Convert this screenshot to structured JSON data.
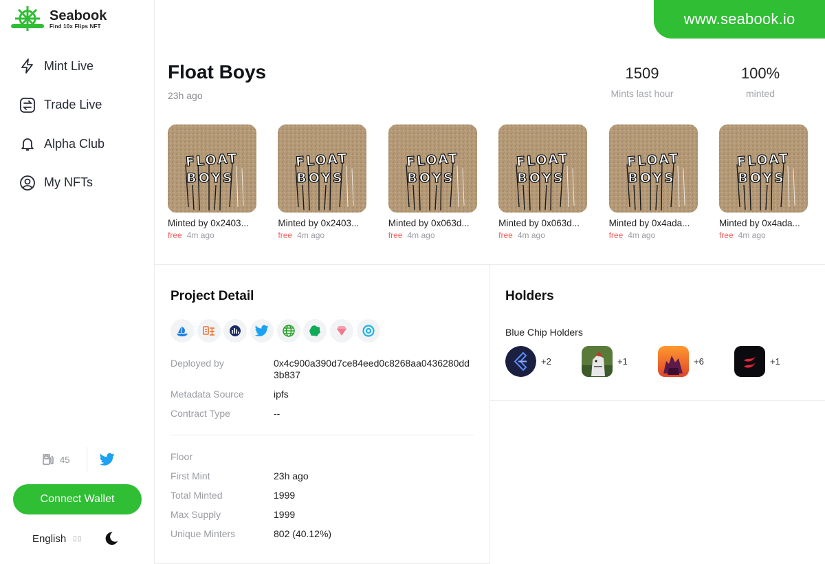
{
  "brand": {
    "name": "Seabook",
    "tagline": "Find 10x Flips NFT",
    "accent": "#2fbe34"
  },
  "banner": {
    "url": "www.seabook.io"
  },
  "nav": {
    "items": [
      {
        "label": "Mint Live",
        "icon": "lightning-icon"
      },
      {
        "label": "Trade Live",
        "icon": "swap-icon"
      },
      {
        "label": "Alpha Club",
        "icon": "bell-icon"
      },
      {
        "label": "My NFTs",
        "icon": "user-circle-icon"
      }
    ]
  },
  "sidebar_footer": {
    "gas": "45",
    "connect_label": "Connect Wallet",
    "language": "English",
    "language_icon": "▯▯"
  },
  "project": {
    "name": "Float Boys",
    "age": "23h ago",
    "stats": [
      {
        "value": "1509",
        "label": "Mints last hour"
      },
      {
        "value": "100%",
        "label": "minted"
      }
    ]
  },
  "mints": [
    {
      "minter": "Minted by 0x2403...",
      "price": "free",
      "time": "4m ago"
    },
    {
      "minter": "Minted by 0x2403...",
      "price": "free",
      "time": "4m ago"
    },
    {
      "minter": "Minted by 0x063d...",
      "price": "free",
      "time": "4m ago"
    },
    {
      "minter": "Minted by 0x063d...",
      "price": "free",
      "time": "4m ago"
    },
    {
      "minter": "Minted by 0x4ada...",
      "price": "free",
      "time": "4m ago"
    },
    {
      "minter": "Minted by 0x4ada...",
      "price": "free",
      "time": "4m ago"
    }
  ],
  "nft_art": {
    "line1": "FLOAT",
    "line2": "BOYS"
  },
  "detail": {
    "title": "Project Detail",
    "socials": [
      "opensea-icon",
      "looksrare-icon",
      "x2y2-icon",
      "twitter-icon",
      "website-icon",
      "gem-icon",
      "diamond-icon",
      "etherscan-icon"
    ],
    "rows": [
      {
        "key": "Deployed by",
        "value": "0x4c900a390d7ce84eed0c8268aa0436280dd3b837"
      },
      {
        "key": "Metadata Source",
        "value": "ipfs"
      },
      {
        "key": "Contract Type",
        "value": "--"
      }
    ],
    "rows2": [
      {
        "key": "Floor",
        "value": ""
      },
      {
        "key": "First Mint",
        "value": "23h ago"
      },
      {
        "key": "Total Minted",
        "value": "1999"
      },
      {
        "key": "Max Supply",
        "value": "1999"
      },
      {
        "key": "Unique Minters",
        "value": "802 (40.12%)"
      }
    ]
  },
  "holders": {
    "title": "Holders",
    "subtitle": "Blue Chip Holders",
    "items": [
      {
        "count": "+2"
      },
      {
        "count": "+1"
      },
      {
        "count": "+6"
      },
      {
        "count": "+1"
      }
    ]
  }
}
